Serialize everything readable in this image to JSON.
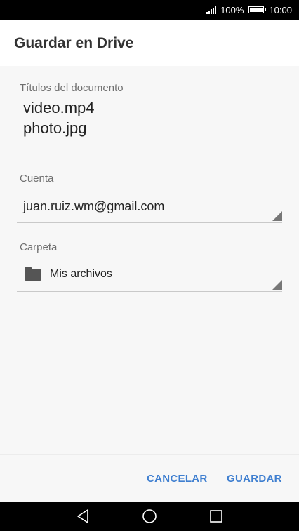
{
  "status_bar": {
    "battery": "100%",
    "time": "10:00"
  },
  "app_bar": {
    "title": "Guardar en Drive"
  },
  "document": {
    "label": "Títulos del documento",
    "files": [
      "video.mp4",
      "photo.jpg"
    ]
  },
  "account": {
    "label": "Cuenta",
    "value": "juan.ruiz.wm@gmail.com"
  },
  "folder": {
    "label": "Carpeta",
    "value": "Mis archivos",
    "icon": "folder-icon"
  },
  "actions": {
    "cancel_label": "CANCELAR",
    "save_label": "GUARDAR"
  },
  "nav_bar": {
    "icons": [
      "back-icon",
      "home-icon",
      "recents-icon"
    ]
  },
  "colors": {
    "accent": "#3f7fd0",
    "background": "#f7f7f7",
    "app_bar": "#ffffff",
    "system_bars": "#000000"
  }
}
